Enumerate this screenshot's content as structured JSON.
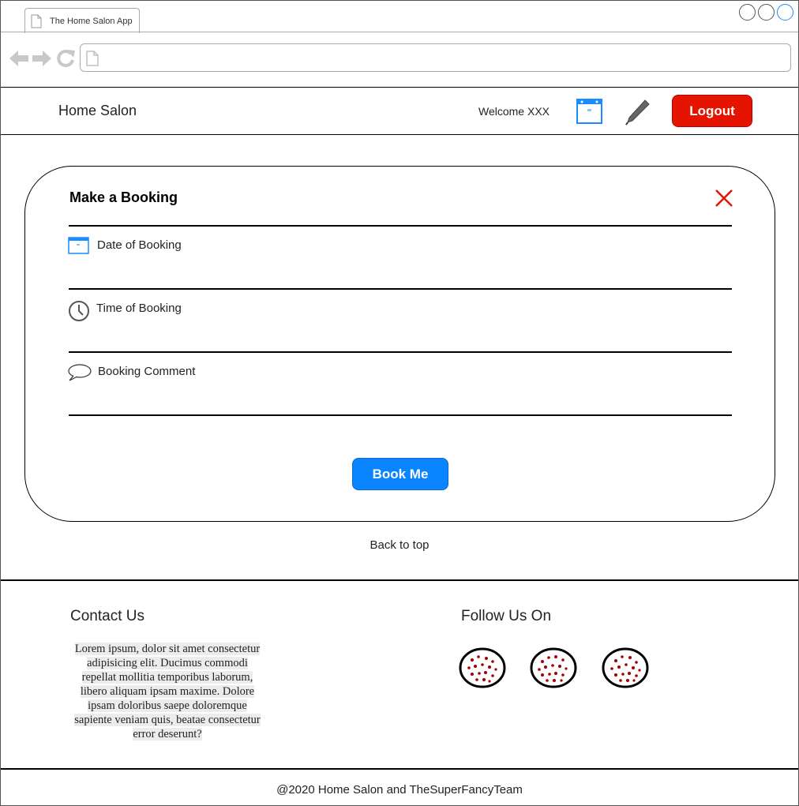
{
  "browser": {
    "tab_title": "The Home Salon App",
    "url": ""
  },
  "header": {
    "brand": "Home Salon",
    "welcome": "Welcome XXX",
    "logout_label": "Logout",
    "calendar_icon": "calendar-icon",
    "edit_icon": "pencil-icon"
  },
  "booking": {
    "title": "Make a Booking",
    "fields": [
      {
        "icon": "calendar-icon",
        "label": "Date of Booking"
      },
      {
        "icon": "clock-icon",
        "label": "Time of Booking"
      },
      {
        "icon": "speech-bubble-icon",
        "label": "Booking Comment"
      }
    ],
    "submit_label": "Book Me"
  },
  "back_to_top": "Back to top",
  "footer": {
    "contact_title": "Contact Us",
    "contact_text": "Lorem ipsum, dolor sit amet consectetur adipisicing elit. Ducimus commodi repellat mollitia temporibus laborum, libero aliquam ipsam maxime. Dolore ipsam doloribus saepe doloremque sapiente veniam quis, beatae consectetur error deserunt?",
    "follow_title": "Follow Us On",
    "social_icons": [
      "social-icon",
      "social-icon",
      "social-icon"
    ]
  },
  "copyright": "@2020 Home Salon and TheSuperFancyTeam",
  "colors": {
    "logout": "#e51400",
    "primary": "#0a84ff",
    "close": "#e51400",
    "icon_blue": "#1a8cff"
  }
}
